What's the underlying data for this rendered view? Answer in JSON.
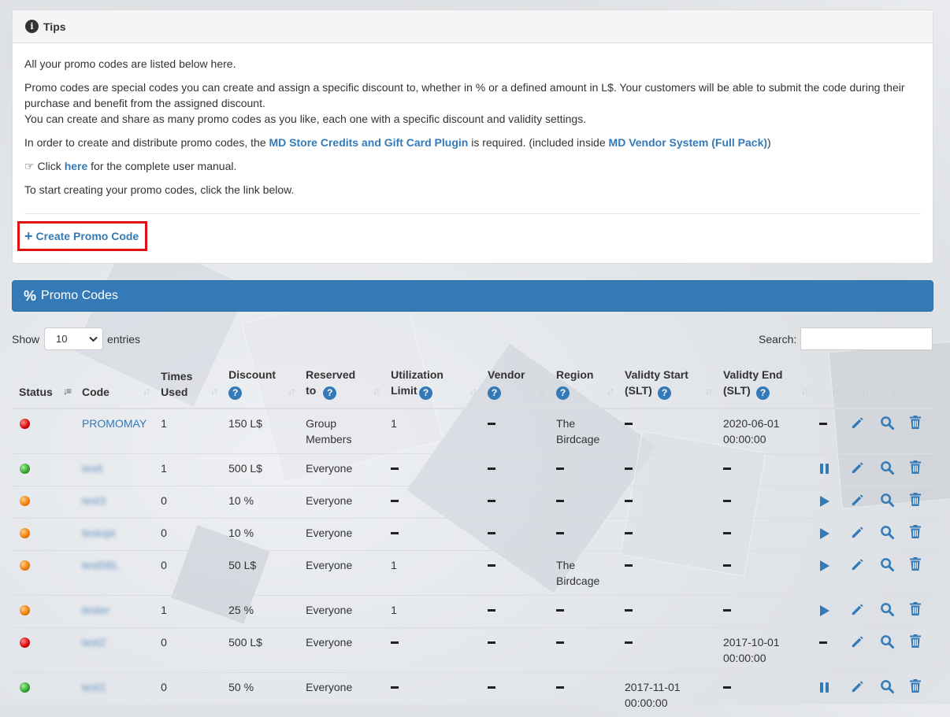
{
  "tips": {
    "title": "Tips",
    "line1": "All your promo codes are listed below here.",
    "line2": "Promo codes are special codes you can create and assign a specific discount to, whether in % or a defined amount in L$. Your customers will be able to submit the code during their purchase and benefit from the assigned discount.",
    "line3": "You can create and share as many promo codes as you like, each one with a specific discount and validity settings.",
    "line4_pre": "In order to create and distribute promo codes, the ",
    "line4_link1": "MD Store Credits and Gift Card Plugin",
    "line4_mid": " is required. (included inside ",
    "line4_link2": "MD Vendor System (Full Pack)",
    "line4_post": ")",
    "line5_pre": " Click ",
    "line5_link": "here",
    "line5_post": " for the complete user manual.",
    "line6": "To start creating your promo codes, click the link below.",
    "create_label": "Create Promo Code"
  },
  "promo": {
    "title": "Promo Codes",
    "show_label": "Show",
    "entries_label": "entries",
    "page_size": "10",
    "search_label": "Search:",
    "search_value": ""
  },
  "columns": {
    "status": "Status",
    "code": "Code",
    "times_used": "Times Used",
    "discount": "Discount",
    "reserved_to": "Reserved to",
    "utilization_limit": "Utilization Limit",
    "vendor": "Vendor",
    "region": "Region",
    "validity_start": "Validty Start (SLT)",
    "validity_end": "Validty End (SLT)"
  },
  "rows": [
    {
      "status": "red",
      "code": "PROMOMAY",
      "blurred": false,
      "times_used": "1",
      "discount": "150 L$",
      "reserved_to": "Group Members",
      "limit": "1",
      "vendor": "",
      "region": "The Birdcage",
      "start": "",
      "end": "2020-06-01 00:00:00",
      "toggle": "none"
    },
    {
      "status": "green",
      "code": "testt",
      "blurred": true,
      "times_used": "1",
      "discount": "500 L$",
      "reserved_to": "Everyone",
      "limit": "",
      "vendor": "",
      "region": "",
      "start": "",
      "end": "",
      "toggle": "pause"
    },
    {
      "status": "orange",
      "code": "test3",
      "blurred": true,
      "times_used": "0",
      "discount": "10 %",
      "reserved_to": "Everyone",
      "limit": "",
      "vendor": "",
      "region": "",
      "start": "",
      "end": "",
      "toggle": "play"
    },
    {
      "status": "orange",
      "code": "testopt",
      "blurred": true,
      "times_used": "0",
      "discount": "10 %",
      "reserved_to": "Everyone",
      "limit": "",
      "vendor": "",
      "region": "",
      "start": "",
      "end": "",
      "toggle": "play"
    },
    {
      "status": "orange",
      "code": "test5BL",
      "blurred": true,
      "times_used": "0",
      "discount": "50 L$",
      "reserved_to": "Everyone",
      "limit": "1",
      "vendor": "",
      "region": "The Birdcage",
      "start": "",
      "end": "",
      "toggle": "play"
    },
    {
      "status": "orange",
      "code": "tester",
      "blurred": true,
      "times_used": "1",
      "discount": "25 %",
      "reserved_to": "Everyone",
      "limit": "1",
      "vendor": "",
      "region": "",
      "start": "",
      "end": "",
      "toggle": "play"
    },
    {
      "status": "red",
      "code": "test2",
      "blurred": true,
      "times_used": "0",
      "discount": "500 L$",
      "reserved_to": "Everyone",
      "limit": "",
      "vendor": "",
      "region": "",
      "start": "",
      "end": "2017-10-01 00:00:00",
      "toggle": "none"
    },
    {
      "status": "green",
      "code": "test1",
      "blurred": true,
      "times_used": "0",
      "discount": "50 %",
      "reserved_to": "Everyone",
      "limit": "",
      "vendor": "",
      "region": "",
      "start": "2017-11-01 00:00:00",
      "end": "",
      "toggle": "pause"
    }
  ],
  "colors": {
    "primary": "#337ab7",
    "highlight_border": "#e01010"
  }
}
